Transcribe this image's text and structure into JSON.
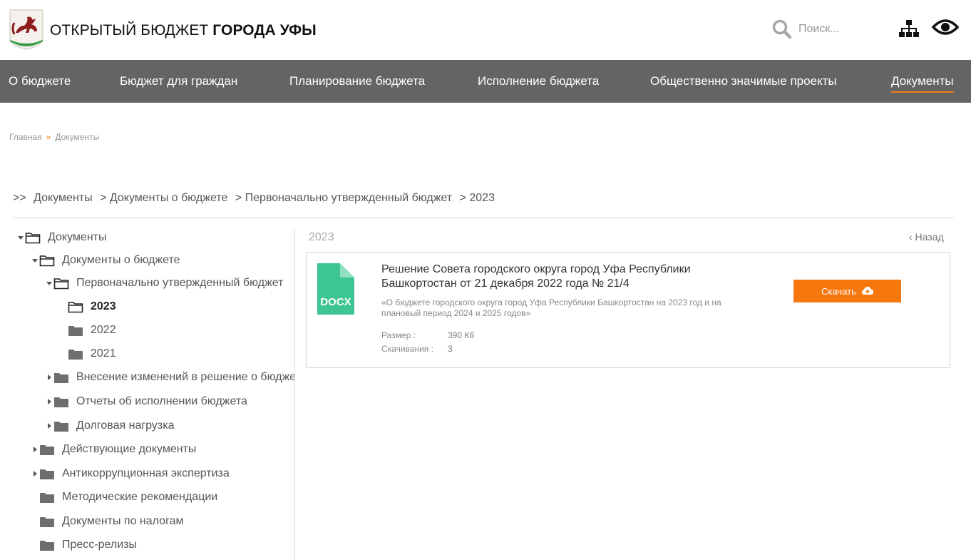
{
  "header": {
    "title_regular": "ОТКРЫТЫЙ БЮДЖЕТ ",
    "title_bold": "ГОРОДА УФЫ",
    "search_placeholder": "Поиск..."
  },
  "nav": [
    {
      "label": "О бюджете",
      "active": false
    },
    {
      "label": "Бюджет для граждан",
      "active": false
    },
    {
      "label": "Планирование бюджета",
      "active": false
    },
    {
      "label": "Исполнение бюджета",
      "active": false
    },
    {
      "label": "Общественно значимые проекты",
      "active": false
    },
    {
      "label": "Документы",
      "active": true
    }
  ],
  "breadcrumb": {
    "home": "Главная",
    "separator": "»",
    "current": "Документы"
  },
  "path": {
    "prefix": ">>",
    "items": [
      "Документы",
      "> Документы о бюджете",
      "> Первоначально утвержденный бюджет",
      "> 2023"
    ]
  },
  "tree": [
    {
      "label": "Документы",
      "arrow": "down",
      "folder": "open"
    },
    {
      "label": "Документы о бюджете",
      "arrow": "down",
      "folder": "open"
    },
    {
      "label": "Первоначально утвержденный бюджет",
      "arrow": "down",
      "folder": "open"
    },
    {
      "label": "2023",
      "arrow": "none",
      "folder": "open",
      "current": true
    },
    {
      "label": "2022",
      "arrow": "none",
      "folder": "closed"
    },
    {
      "label": "2021",
      "arrow": "none",
      "folder": "closed"
    },
    {
      "label": "Внесение изменений в решение о бюджете",
      "arrow": "right",
      "folder": "closed"
    },
    {
      "label": "Отчеты об исполнении бюджета",
      "arrow": "right",
      "folder": "closed"
    },
    {
      "label": "Долговая нагрузка",
      "arrow": "right",
      "folder": "closed"
    },
    {
      "label": "Действующие документы",
      "arrow": "right",
      "folder": "closed"
    },
    {
      "label": "Антикоррупционная экспертиза",
      "arrow": "right",
      "folder": "closed"
    },
    {
      "label": "Методические рекомендации",
      "arrow": "none",
      "folder": "closed"
    },
    {
      "label": "Документы по налогам",
      "arrow": "none",
      "folder": "closed"
    },
    {
      "label": "Пресс-релизы",
      "arrow": "none",
      "folder": "closed"
    }
  ],
  "panel": {
    "title": "2023",
    "back_label": "‹ Назад"
  },
  "document": {
    "file_type": "DOCX",
    "title": "Решение Совета городского округа город Уфа Республики Башкортостан от 21 декабря 2022 года № 21/4",
    "description": "«О бюджете городского округа город Уфа Республики Башкортостан на 2023 год и на плановый период 2024 и 2025 годов»",
    "size_label": "Размер :",
    "size_value": "390 Кб",
    "downloads_label": "Скачивания :",
    "downloads_value": "3",
    "download_button": "Скачать"
  },
  "colors": {
    "nav_bg": "#646464",
    "accent": "#f7770f",
    "docx": "#3ec594",
    "folder": "#6e6e6e"
  }
}
